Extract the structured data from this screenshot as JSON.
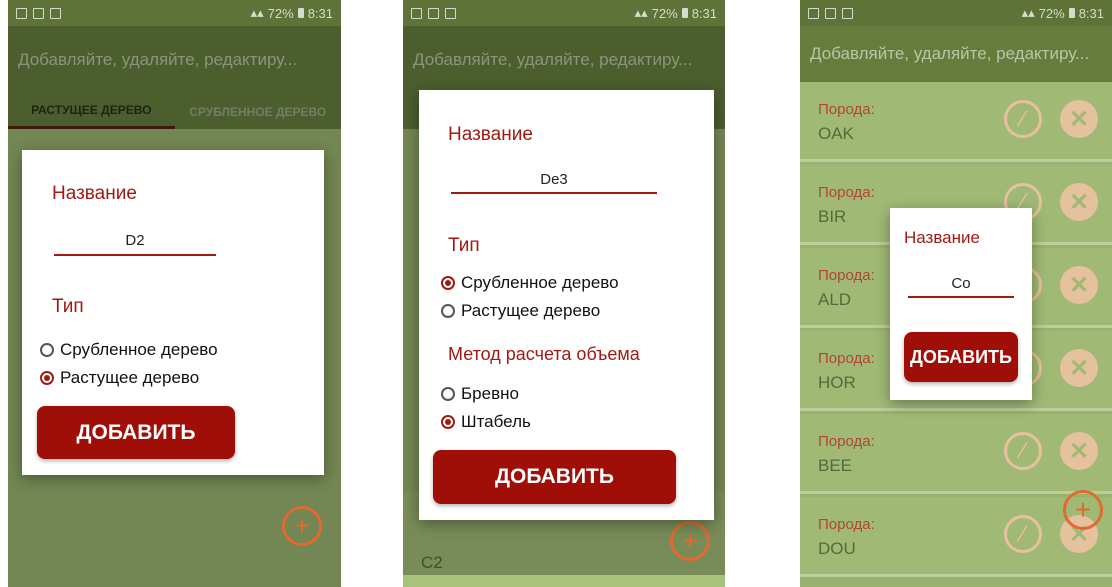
{
  "status_bar": {
    "battery": "72%",
    "time": "8:31"
  },
  "app_title": "Добавляйте, удаляйте, редактиру...",
  "tabs": [
    "РАСТУЩЕЕ ДЕРЕВО",
    "СРУБЛЕННОЕ ДЕРЕВО"
  ],
  "icons": {
    "edit": "edit-icon",
    "delete": "delete-icon",
    "add": "add-icon"
  },
  "colors": {
    "accent": "#a11a12",
    "button": "#9f0f07",
    "appbar": "#6a8240",
    "fab": "#e36a2e"
  },
  "screen1": {
    "dialog": {
      "name_label": "Название",
      "name_value": "D2",
      "type_label": "Тип",
      "radio_options": [
        "Срубленное дерево",
        "Растущее дерево"
      ],
      "selected_index": 1,
      "add_button": "ДОБАВИТЬ"
    }
  },
  "screen2": {
    "visible_list_text": "C2",
    "dialog": {
      "name_label": "Название",
      "name_value": "De3",
      "type_label": "Тип",
      "type_options": [
        "Срубленное дерево",
        "Растущее дерево"
      ],
      "type_selected_index": 0,
      "method_label": "Метод расчета объема",
      "method_options": [
        "Бревно",
        "Штабель"
      ],
      "method_selected_index": 1,
      "add_button": "ДОБАВИТЬ"
    }
  },
  "screen3": {
    "breed_label": "Порода:",
    "items": [
      "OAK",
      "BIR",
      "ALD",
      "HOR",
      "BEE",
      "DOU"
    ],
    "dialog": {
      "name_label": "Название",
      "name_value": "Co",
      "add_button": "ДОБАВИТЬ"
    }
  }
}
